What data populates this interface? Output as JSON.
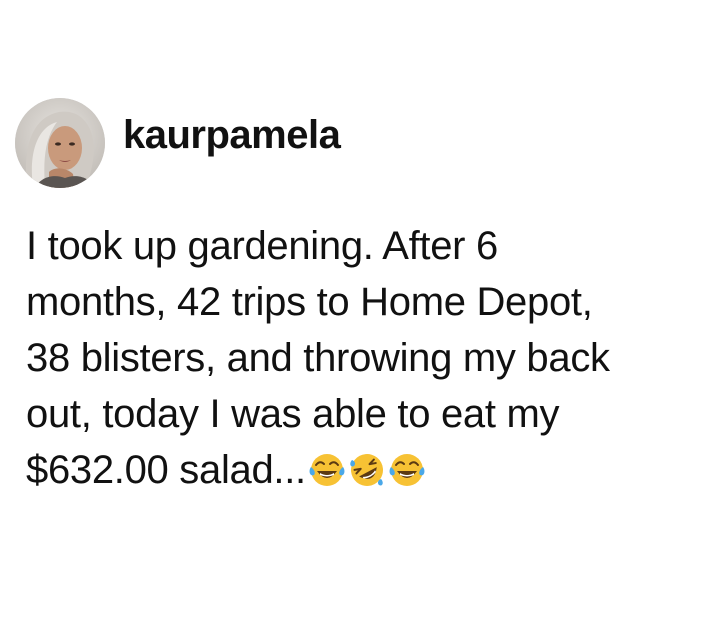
{
  "post": {
    "username": "kaurpamela",
    "text_lines": [
      "I took up gardening. After 6",
      "months, 42 trips to Home Depot,",
      "38 blisters, and throwing my back",
      "out, today I was able to eat my",
      "$632.00 salad..."
    ],
    "emojis": [
      "face-with-tears-of-joy-icon",
      "rolling-on-the-floor-laughing-icon",
      "face-with-tears-of-joy-icon"
    ]
  },
  "colors": {
    "background": "#ffffff",
    "text": "#111111",
    "emoji_yellow": "#f7c234",
    "emoji_tears": "#4aa8e8"
  }
}
